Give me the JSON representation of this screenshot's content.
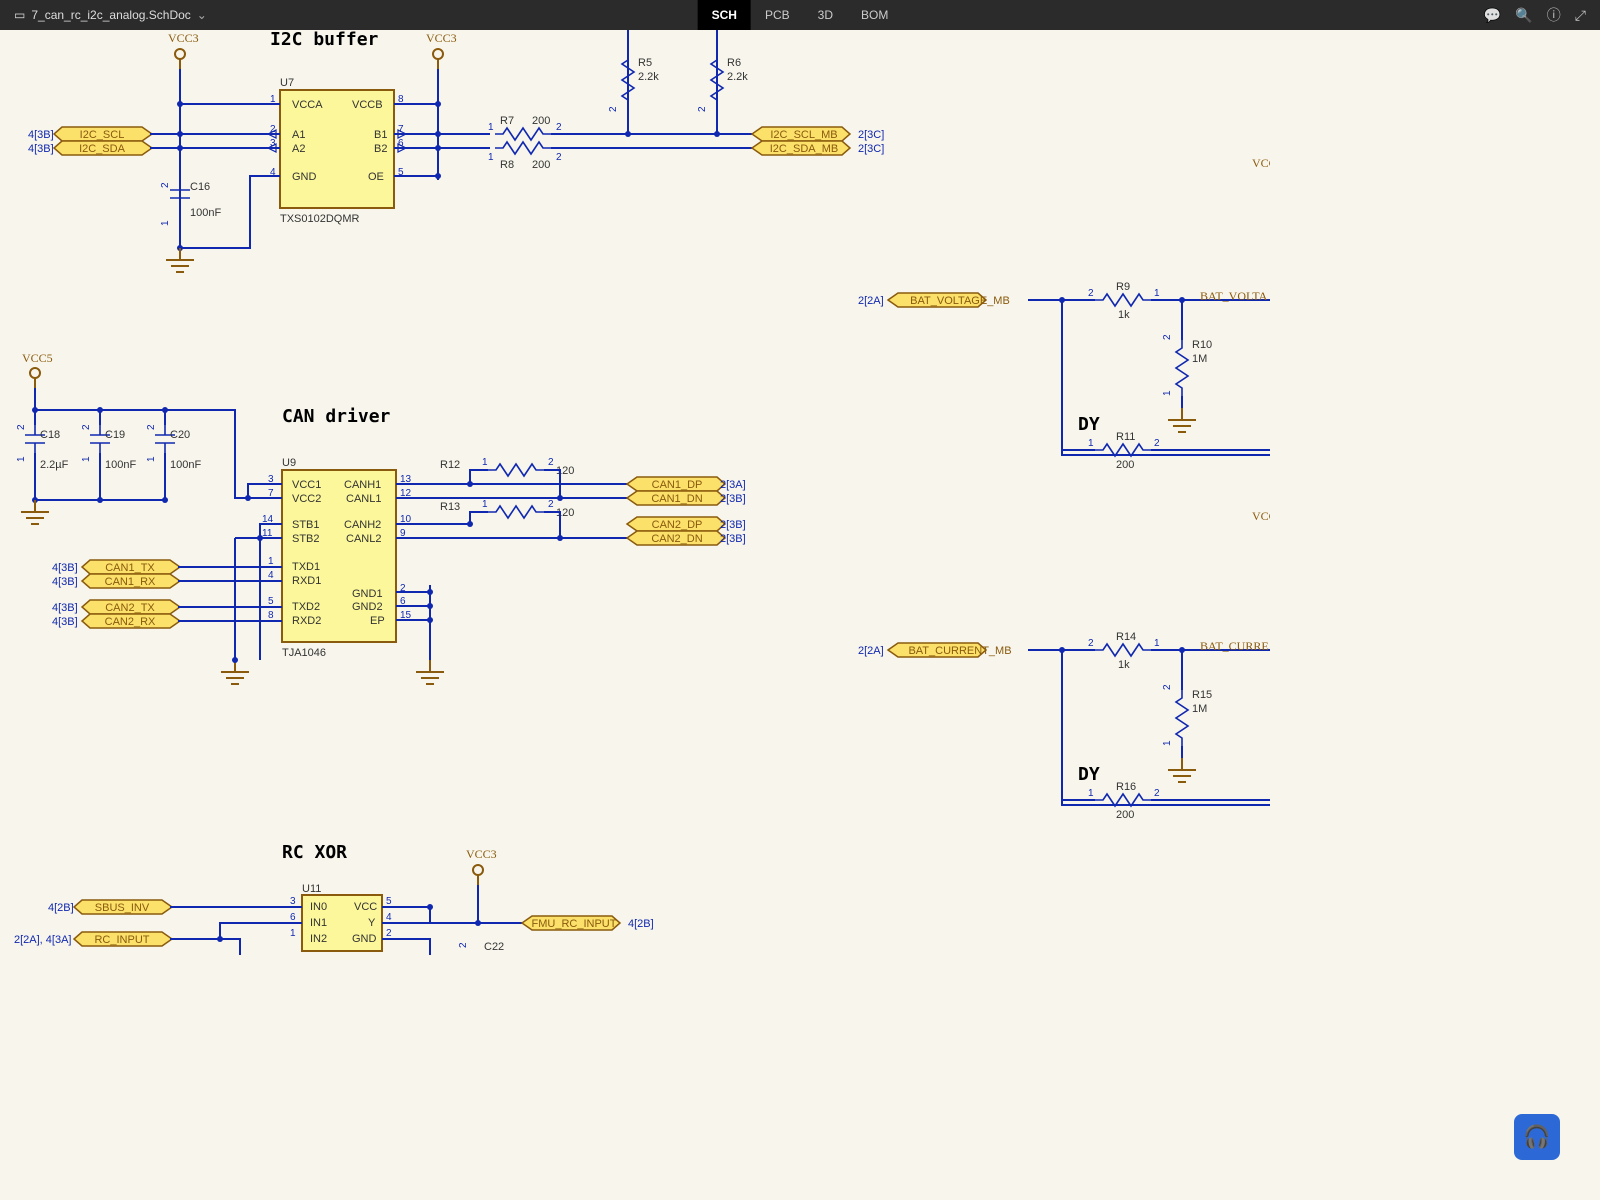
{
  "header": {
    "filename": "7_can_rc_i2c_analog.SchDoc"
  },
  "tabs": [
    "SCH",
    "PCB",
    "3D",
    "BOM"
  ],
  "sections": {
    "i2c": "I2C buffer",
    "can": "CAN driver",
    "rc": "RC XOR",
    "dy1": "DY",
    "dy2": "DY"
  },
  "power": {
    "vcc3": "VCC3",
    "vcc5": "VCC5",
    "vcc": "VCC"
  },
  "ports": {
    "i2c_scl": "I2C_SCL",
    "i2c_sda": "I2C_SDA",
    "i2c_scl_mb": "I2C_SCL_MB",
    "i2c_sda_mb": "I2C_SDA_MB",
    "can1_tx": "CAN1_TX",
    "can1_rx": "CAN1_RX",
    "can2_tx": "CAN2_TX",
    "can2_rx": "CAN2_RX",
    "can1_dp": "CAN1_DP",
    "can1_dn": "CAN1_DN",
    "can2_dp": "CAN2_DP",
    "can2_dn": "CAN2_DN",
    "sbus_inv": "SBUS_INV",
    "rc_input": "RC_INPUT",
    "fmu_rc_input": "FMU_RC_INPUT",
    "bat_v_mb": "BAT_VOLTAGE_MB",
    "bat_v": "BAT_VOLTA",
    "bat_c_mb": "BAT_CURRENT_MB",
    "bat_c": "BAT_CURRE"
  },
  "refs": {
    "i2c_scl": "4[3B]",
    "i2c_sda": "4[3B]",
    "i2c_scl_mb": "2[3C]",
    "i2c_sda_mb": "2[3C]",
    "can1_tx": "4[3B]",
    "can1_rx": "4[3B]",
    "can2_tx": "4[3B]",
    "can2_rx": "4[3B]",
    "can1_dp": "2[3A]",
    "can1_dn": "2[3B]",
    "can2_dp": "2[3B]",
    "can2_dn": "2[3B]",
    "sbus_inv": "4[2B]",
    "rc_input": "2[2A], 4[3A]",
    "fmu_rc_input": "4[2B]",
    "bat_v_mb": "2[2A]",
    "bat_c_mb": "2[2A]"
  },
  "ic": {
    "u7": {
      "des": "U7",
      "part": "TXS0102DQMR",
      "pins_l": [
        "VCCA",
        "A1",
        "A2",
        "GND"
      ],
      "pins_r": [
        "VCCB",
        "B1",
        "B2",
        "OE"
      ],
      "nums_l": [
        "1",
        "2",
        "3",
        "4"
      ],
      "nums_r": [
        "8",
        "7",
        "6",
        "5"
      ]
    },
    "u9": {
      "des": "U9",
      "part": "TJA1046",
      "pins_l": [
        "VCC1",
        "VCC2",
        "STB1",
        "STB2",
        "TXD1",
        "RXD1",
        "TXD2",
        "RXD2"
      ],
      "pins_r": [
        "CANH1",
        "CANL1",
        "CANH2",
        "CANL2",
        "GND1",
        "GND2",
        "EP"
      ],
      "nums_l": [
        "3",
        "7",
        "14",
        "11",
        "1",
        "4",
        "5",
        "8"
      ],
      "nums_r": [
        "13",
        "12",
        "10",
        "9",
        "2",
        "6",
        "15"
      ]
    },
    "u11": {
      "des": "U11",
      "pins_l": [
        "IN0",
        "IN1",
        "IN2"
      ],
      "pins_r": [
        "VCC",
        "Y",
        "GND"
      ],
      "nums_l": [
        "3",
        "6",
        "1"
      ],
      "nums_r": [
        "5",
        "4",
        "2"
      ]
    }
  },
  "parts": {
    "c16": {
      "d": "C16",
      "v": "100nF"
    },
    "c18": {
      "d": "C18",
      "v": "2.2µF"
    },
    "c19": {
      "d": "C19",
      "v": "100nF"
    },
    "c20": {
      "d": "C20",
      "v": "100nF"
    },
    "c22": {
      "d": "C22"
    },
    "r5": {
      "d": "R5",
      "v": "2.2k"
    },
    "r6": {
      "d": "R6",
      "v": "2.2k"
    },
    "r7": {
      "d": "R7",
      "v": "200"
    },
    "r8": {
      "d": "R8",
      "v": "200"
    },
    "r9": {
      "d": "R9",
      "v": "1k"
    },
    "r10": {
      "d": "R10",
      "v": "1M"
    },
    "r11": {
      "d": "R11",
      "v": "200"
    },
    "r12": {
      "d": "R12",
      "v": "120"
    },
    "r13": {
      "d": "R13",
      "v": "120"
    },
    "r14": {
      "d": "R14",
      "v": "1k"
    },
    "r15": {
      "d": "R15",
      "v": "1M"
    },
    "r16": {
      "d": "R16",
      "v": "200"
    }
  }
}
